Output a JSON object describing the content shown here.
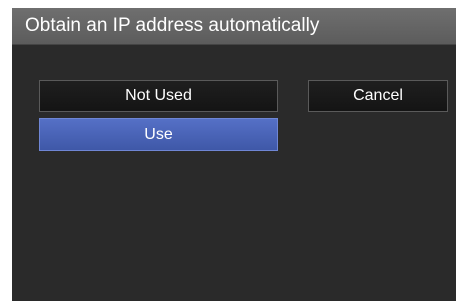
{
  "dialog": {
    "title": "Obtain an IP address automatically",
    "buttons": {
      "not_used": "Not Used",
      "cancel": "Cancel",
      "use": "Use"
    }
  },
  "colors": {
    "background": "#2a2a2a",
    "titlebar": "#666666",
    "selected_button": "#4a63b6",
    "text": "#ffffff"
  }
}
